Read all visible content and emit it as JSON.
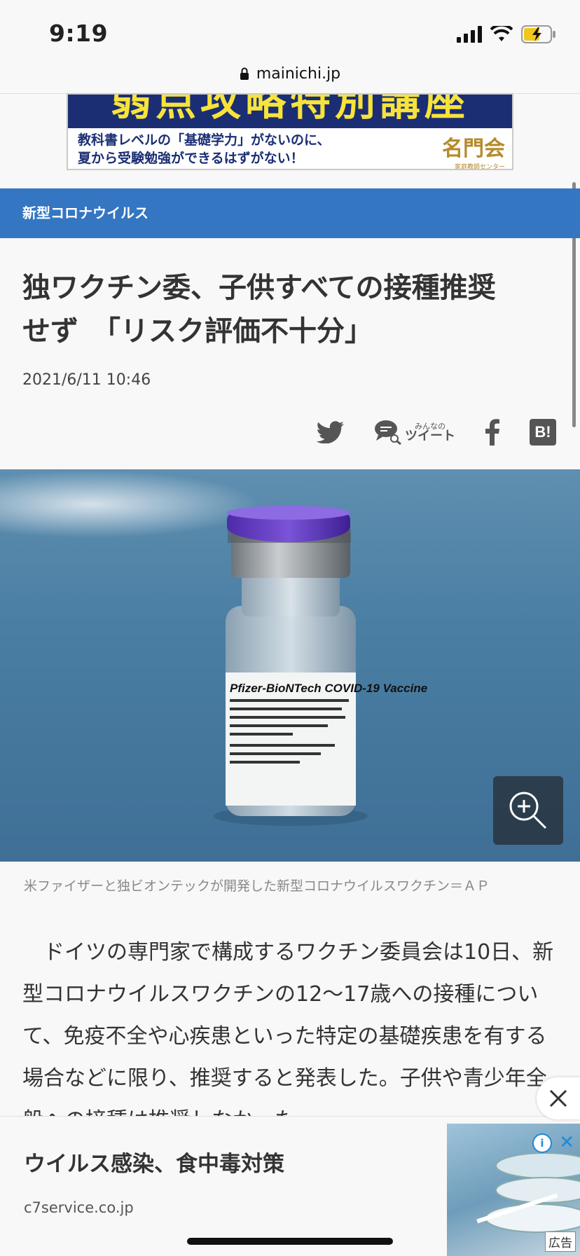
{
  "status_bar": {
    "time": "9:19"
  },
  "browser": {
    "url": "mainichi.jp"
  },
  "top_ad": {
    "headline": "弱点攻略特別講座",
    "line1": "教科書レベルの「基礎学力」がないのに、",
    "line2": "夏から受験勉強ができるはずがない！",
    "brand": "名門会",
    "brand_sub": "家庭教師センター"
  },
  "category": {
    "label": "新型コロナウイルス"
  },
  "article": {
    "headline_line1": "独ワクチン委、子供すべての接種推奨",
    "headline_line2": "せず　「リスク評価不十分」",
    "date": "2021/6/11 10:46",
    "share": {
      "minna_label": "みんなの",
      "tweet_label": "ツイート",
      "hatena_label": "B!"
    },
    "photo_caption": "米ファイザーと独ビオンテックが開発した新型コロナウイルスワクチン＝ＡＰ",
    "vial_label": "Pfizer-BioNTech COVID-19 Vaccine",
    "body": "　ドイツの専門家で構成するワクチン委員会は10日、新型コロナウイルスワクチンの12～17歳への接種について、免疫不全や心疾患といった特定の基礎疾患を有する場合などに限り、推奨すると発表した。子供や青少年全般への接種は推奨しなかった。"
  },
  "bottom_ad": {
    "title": "ウイルス感染、食中毒対策",
    "domain": "c7service.co.jp",
    "label": "広告"
  }
}
